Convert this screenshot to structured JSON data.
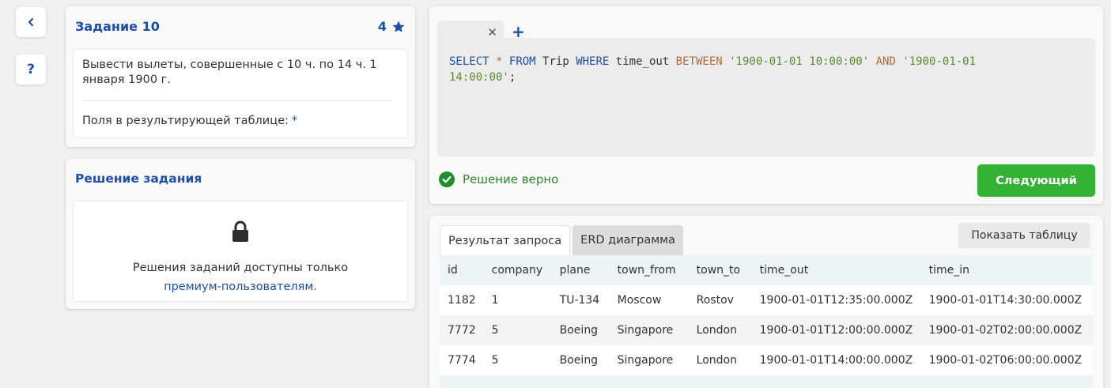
{
  "nav": {
    "back_icon": "chevron-left-icon",
    "help_label": "?"
  },
  "task": {
    "title": "Задание 10",
    "points": "4",
    "description": "Вывести вылеты, совершенные с 10 ч. по 14 ч. 1 января 1900 г.",
    "fields_label": "Поля в результирующей таблице:",
    "fields_value": "*"
  },
  "solution": {
    "title": "Решение задания",
    "locked_text": "Решения заданий доступны только",
    "locked_link": "премиум-пользователям."
  },
  "editor": {
    "tab_close": "✕",
    "tab_add": "+",
    "code": {
      "t1": "SELECT",
      "t2": "*",
      "t3": "FROM",
      "t4": "Trip",
      "t5": "WHERE",
      "t6": "time_out",
      "t7": "BETWEEN",
      "t8": "'1900-01-01 10:00:00'",
      "t9": "AND",
      "t10": "'1900-01-01",
      "t11": "14:00:00'",
      "t12": ";"
    },
    "status_text": "Решение верно",
    "next_button": "Следующий"
  },
  "results": {
    "tabs": [
      {
        "label": "Результат запроса",
        "active": true
      },
      {
        "label": "ERD диаграмма",
        "active": false
      }
    ],
    "show_table_button": "Показать таблицу",
    "columns": [
      "id",
      "company",
      "plane",
      "town_from",
      "town_to",
      "time_out",
      "time_in"
    ],
    "rows": [
      [
        "1182",
        "1",
        "TU-134",
        "Moscow",
        "Rostov",
        "1900-01-01T12:35:00.000Z",
        "1900-01-01T14:30:00.000Z"
      ],
      [
        "7772",
        "5",
        "Boeing",
        "Singapore",
        "London",
        "1900-01-01T12:00:00.000Z",
        "1900-01-02T02:00:00.000Z"
      ],
      [
        "7774",
        "5",
        "Boeing",
        "Singapore",
        "London",
        "1900-01-01T14:00:00.000Z",
        "1900-01-02T06:00:00.000Z"
      ]
    ]
  },
  "colors": {
    "accent": "#1d4fa8",
    "success": "#34b233",
    "status_green": "#2a8a2a"
  }
}
